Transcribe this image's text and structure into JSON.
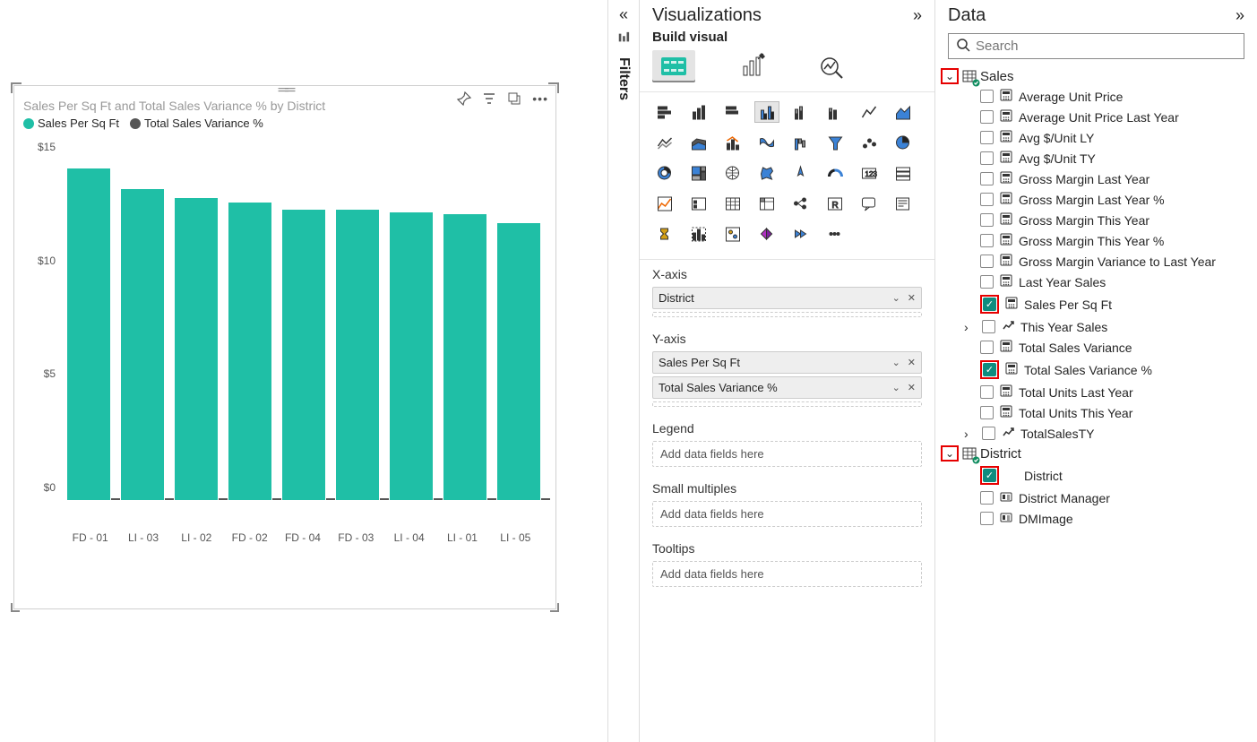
{
  "chart": {
    "title": "Sales Per Sq Ft and Total Sales Variance % by District",
    "legend": [
      {
        "label": "Sales Per Sq Ft",
        "color": "#1fbfa6"
      },
      {
        "label": "Total Sales Variance %",
        "color": "#555555"
      }
    ],
    "y_ticks": [
      "$0",
      "$5",
      "$10",
      "$15"
    ],
    "actions_title": {
      "pin": "Pin",
      "filter": "Filter",
      "focus": "Focus mode",
      "more": "More options"
    }
  },
  "chart_data": {
    "type": "bar",
    "title": "Sales Per Sq Ft and Total Sales Variance % by District",
    "xlabel": "District",
    "ylabel": "",
    "ylim": [
      0,
      16
    ],
    "categories": [
      "FD - 01",
      "LI - 03",
      "LI - 02",
      "FD - 02",
      "FD - 04",
      "FD - 03",
      "LI - 04",
      "LI - 01",
      "LI - 05"
    ],
    "series": [
      {
        "name": "Sales Per Sq Ft",
        "color": "#1fbfa6",
        "values": [
          14.6,
          13.7,
          13.3,
          13.1,
          12.8,
          12.8,
          12.7,
          12.6,
          12.2
        ]
      },
      {
        "name": "Total Sales Variance %",
        "color": "#555555",
        "values": [
          0.0,
          0.0,
          0.0,
          0.0,
          0.0,
          0.0,
          0.0,
          0.0,
          0.0
        ]
      }
    ]
  },
  "filters_label": "Filters",
  "viz": {
    "panel_title": "Visualizations",
    "subtitle": "Build visual",
    "wells": {
      "xaxis": {
        "label": "X-axis",
        "chips": [
          "District"
        ]
      },
      "yaxis": {
        "label": "Y-axis",
        "chips": [
          "Sales Per Sq Ft",
          "Total Sales Variance %"
        ]
      },
      "legend": {
        "label": "Legend",
        "placeholder": "Add data fields here"
      },
      "small": {
        "label": "Small multiples",
        "placeholder": "Add data fields here"
      },
      "tooltips": {
        "label": "Tooltips",
        "placeholder": "Add data fields here"
      }
    }
  },
  "data_panel": {
    "title": "Data",
    "search_placeholder": "Search",
    "tables": [
      {
        "name": "Sales",
        "highlight": true,
        "fields": [
          {
            "name": "Average Unit Price",
            "icon": "calc",
            "checked": false
          },
          {
            "name": "Average Unit Price Last Year",
            "icon": "calc",
            "checked": false
          },
          {
            "name": "Avg $/Unit LY",
            "icon": "calc",
            "checked": false
          },
          {
            "name": "Avg $/Unit TY",
            "icon": "calc",
            "checked": false
          },
          {
            "name": "Gross Margin Last Year",
            "icon": "calc",
            "checked": false
          },
          {
            "name": "Gross Margin Last Year %",
            "icon": "calc",
            "checked": false
          },
          {
            "name": "Gross Margin This Year",
            "icon": "calc",
            "checked": false
          },
          {
            "name": "Gross Margin This Year %",
            "icon": "calc",
            "checked": false
          },
          {
            "name": "Gross Margin Variance to Last Year",
            "icon": "calc",
            "checked": false
          },
          {
            "name": "Last Year Sales",
            "icon": "calc",
            "checked": false
          },
          {
            "name": "Sales Per Sq Ft",
            "icon": "calc",
            "checked": true,
            "highlight": true
          },
          {
            "name": "This Year Sales",
            "icon": "hier",
            "checked": false,
            "expandable": true
          },
          {
            "name": "Total Sales Variance",
            "icon": "calc",
            "checked": false
          },
          {
            "name": "Total Sales Variance %",
            "icon": "calc",
            "checked": true,
            "highlight": true
          },
          {
            "name": "Total Units Last Year",
            "icon": "calc",
            "checked": false
          },
          {
            "name": "Total Units This Year",
            "icon": "calc",
            "checked": false
          },
          {
            "name": "TotalSalesTY",
            "icon": "hier",
            "checked": false,
            "expandable": true
          }
        ]
      },
      {
        "name": "District",
        "highlight": true,
        "fields": [
          {
            "name": "District",
            "icon": "blank",
            "checked": true,
            "highlight": true
          },
          {
            "name": "District Manager",
            "icon": "card",
            "checked": false
          },
          {
            "name": "DMImage",
            "icon": "card",
            "checked": false
          }
        ]
      }
    ]
  }
}
